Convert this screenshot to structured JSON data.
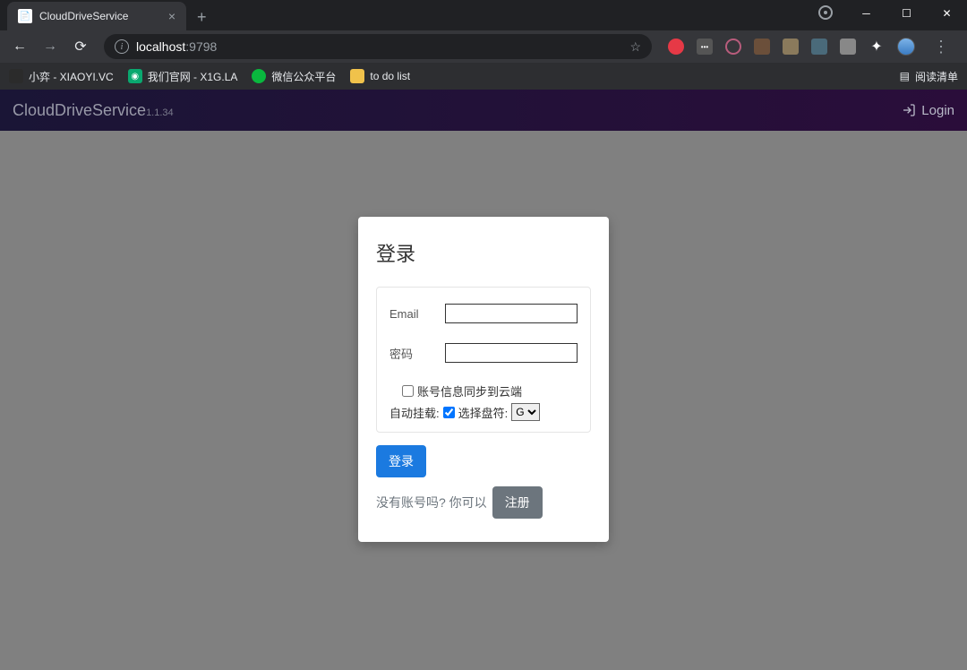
{
  "browser": {
    "tab_title": "CloudDriveService",
    "url_host": "localhost",
    "url_port": ":9798",
    "bookmarks": [
      {
        "label": "小弈 - XIAOYI.VC",
        "color": "#2b2b2b"
      },
      {
        "label": "我们官网 - X1G.LA",
        "color": "#0aa86f"
      },
      {
        "label": "微信公众平台",
        "color": "#09b83e"
      },
      {
        "label": "to do list",
        "color": "#f0c24b"
      }
    ],
    "reading_list": "阅读清单"
  },
  "app": {
    "brand": "CloudDriveService",
    "version": "1.1.34",
    "login_nav": "Login"
  },
  "form": {
    "title": "登录",
    "email_label": "Email",
    "password_label": "密码",
    "sync_label": "账号信息同步到云端",
    "automount_prefix": "自动挂载:",
    "drive_select_label": "选择盘符:",
    "drive_options": [
      "G"
    ],
    "submit": "登录",
    "no_account_text": "没有账号吗? 你可以",
    "register": "注册"
  }
}
